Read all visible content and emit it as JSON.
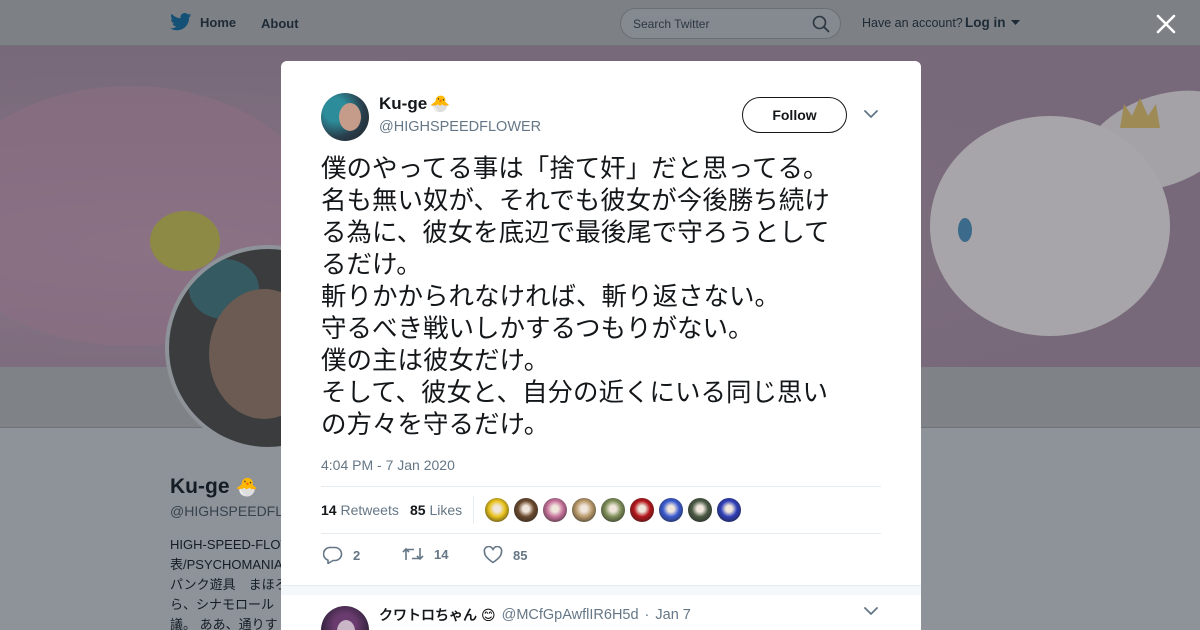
{
  "nav": {
    "home_label": "Home",
    "about_label": "About",
    "search_placeholder": "Search Twitter",
    "have_account": "Have an account?",
    "login_label": "Log in"
  },
  "profile_bg": {
    "name": "Ku-ge",
    "handle": "@HIGHSPEEDFLOWER",
    "bio_lines": [
      "HIGH-SPEED-FLOWER代",
      "表/PSYCHOMANIA",
      "パンク遊具　まほろ",
      "ら、シナモロール",
      "議。 ああ、通りす"
    ]
  },
  "tweet": {
    "author_name": "Ku-ge",
    "author_emoji": "🐣",
    "author_handle": "@HIGHSPEEDFLOWER",
    "follow_label": "Follow",
    "text_lines": [
      "僕のやってる事は「捨て奸」だと思ってる。",
      "名も無い奴が、それでも彼女が今後勝ち続け",
      "る為に、彼女を底辺で最後尾で守ろうとして",
      "るだけ。",
      "斬りかかられなければ、斬り返さない。",
      "守るべき戦いしかするつもりがない。",
      "僕の主は彼女だけ。",
      "そして、彼女と、自分の近くにいる同じ思い",
      "の方々を守るだけ。"
    ],
    "timestamp": "4:04 PM - 7 Jan 2020",
    "retweets_count": "14",
    "retweets_label": "Retweets",
    "likes_count": "85",
    "likes_label": "Likes",
    "liker_colors": [
      "#e8c21c",
      "#6b4a2e",
      "#c7739c",
      "#b99a6b",
      "#7f8f5a",
      "#b4161b",
      "#3a5bd0",
      "#4a5a44",
      "#2f3fb8"
    ],
    "actions": {
      "replies": "2",
      "retweets": "14",
      "likes": "85"
    }
  },
  "reply": {
    "name": "クワトロちゃん",
    "emoji": "😊",
    "handle": "@MCfGpAwflIR6H5d",
    "sep": "·",
    "date": "Jan 7"
  },
  "colors": {
    "twitter_blue": "#1da1f2",
    "text_primary": "#14171a",
    "text_secondary": "#657786"
  }
}
